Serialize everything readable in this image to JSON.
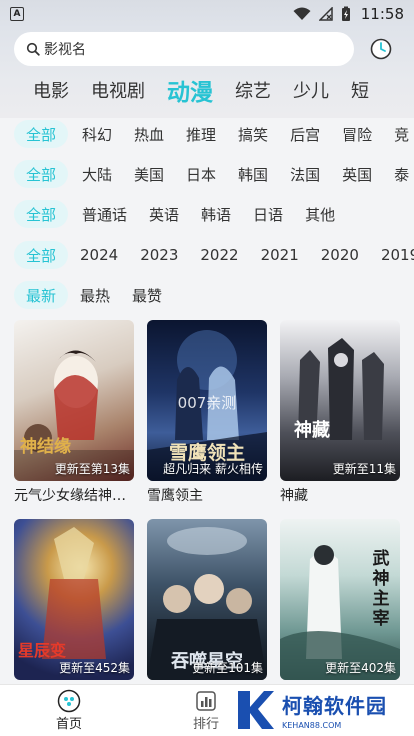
{
  "status": {
    "time": "11:58",
    "app_icon_letter": "A"
  },
  "search": {
    "placeholder": "影视名"
  },
  "main_tabs": [
    "电影",
    "电视剧",
    "动漫",
    "综艺",
    "少儿",
    "短"
  ],
  "main_tab_active_index": 2,
  "filters": {
    "genre": {
      "selected": "全部",
      "options": [
        "科幻",
        "热血",
        "推理",
        "搞笑",
        "后宫",
        "冒险",
        "竞"
      ]
    },
    "region": {
      "selected": "全部",
      "options": [
        "大陆",
        "美国",
        "日本",
        "韩国",
        "法国",
        "英国",
        "泰"
      ]
    },
    "language": {
      "selected": "全部",
      "options": [
        "普通话",
        "英语",
        "韩语",
        "日语",
        "其他"
      ]
    },
    "year": {
      "selected": "全部",
      "options": [
        "2024",
        "2023",
        "2022",
        "2021",
        "2020",
        "2019"
      ]
    },
    "sort": {
      "selected": "最新",
      "options": [
        "最热",
        "最赞"
      ]
    }
  },
  "cards": [
    {
      "title": "元气少女缘结神第三季",
      "caption": "更新至第13集",
      "center_text": "",
      "art_text": "神结缘",
      "colors": [
        "#f2f0ee",
        "#c9b9a8",
        "#7a3b33"
      ]
    },
    {
      "title": "雪鹰领主",
      "caption": "超凡归来 薪火相传",
      "center_text": "007亲测",
      "art_text": "雪鹰领主",
      "colors": [
        "#0e1a33",
        "#2a3e6b",
        "#5a7fb8"
      ]
    },
    {
      "title": "神藏",
      "caption": "更新至11集",
      "center_text": "",
      "art_text": "神藏",
      "colors": [
        "#e9e9ec",
        "#6d6f78",
        "#2a2b30"
      ]
    },
    {
      "title": "",
      "caption": "更新至452集",
      "center_text": "",
      "art_text": "星辰变",
      "colors": [
        "#2b3c7a",
        "#c9a25a",
        "#7a2b24"
      ]
    },
    {
      "title": "",
      "caption": "更新至101集",
      "center_text": "",
      "art_text": "吞噬星空",
      "colors": [
        "#1f2d3c",
        "#536b82",
        "#93a9bd"
      ]
    },
    {
      "title": "",
      "caption": "更新至402集",
      "center_text": "",
      "art_text": "武神主宰",
      "colors": [
        "#e8efee",
        "#93b9b4",
        "#3f6b66"
      ]
    }
  ],
  "bottom_nav": {
    "home_label": "首页",
    "rank_label": "排行"
  },
  "watermark": {
    "title": "柯翰软件园",
    "sub": "KEHAN88.COM"
  },
  "colors": {
    "accent": "#27c3d3",
    "pill_bg": "#e3f6f8",
    "watermark": "#1a4fb0"
  }
}
